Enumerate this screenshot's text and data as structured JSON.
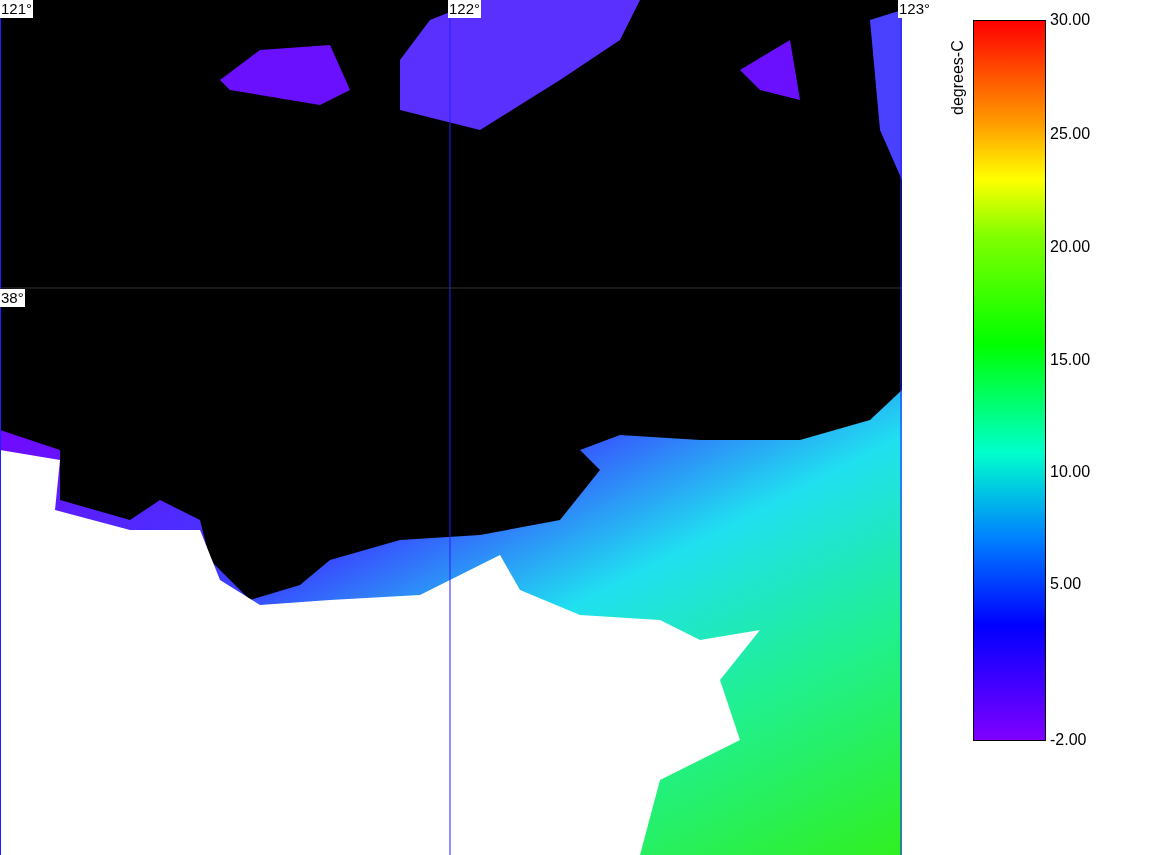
{
  "map": {
    "grid_labels": [
      {
        "kind": "longitude",
        "text": "121°"
      },
      {
        "kind": "longitude",
        "text": "122°"
      },
      {
        "kind": "longitude",
        "text": "123°"
      },
      {
        "kind": "latitude",
        "text": "38°"
      }
    ]
  },
  "colorbar": {
    "title": "degrees-C",
    "ticks": [
      "30.00",
      "25.00",
      "20.00",
      "15.00",
      "10.00",
      "5.00",
      "-2.00"
    ]
  }
}
